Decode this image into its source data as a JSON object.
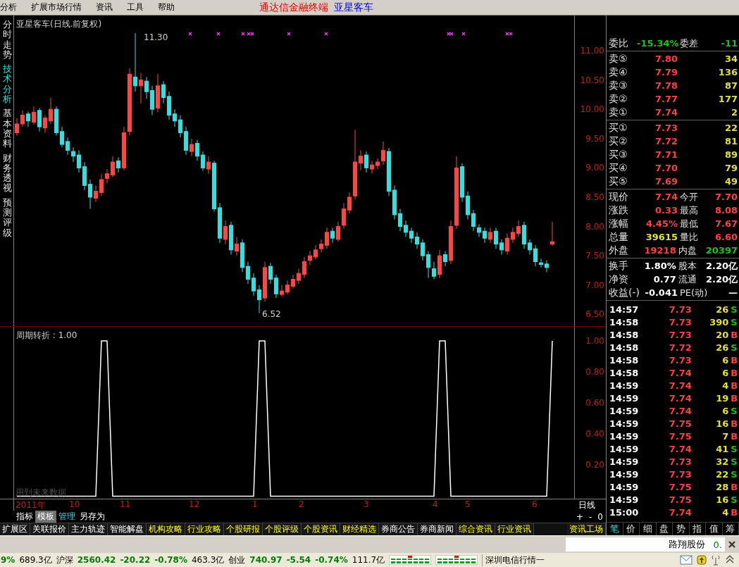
{
  "menu": [
    "分析",
    "扩展市场行情",
    "资讯",
    "工具",
    "帮助"
  ],
  "app_title": {
    "product": "通达信金融终端",
    "stock": "亚星客车"
  },
  "side_tabs": [
    {
      "label": "分时走势",
      "selected": false
    },
    {
      "label": "技术分析",
      "selected": true
    },
    {
      "label": "基本资料",
      "selected": false
    },
    {
      "label": "财务透视",
      "selected": false
    },
    {
      "label": "预测评级",
      "selected": false
    }
  ],
  "main_chart": {
    "title": "亚星客车(日线.前复权)",
    "high_label": "11.30",
    "low_label": "6.52",
    "chart_data": {
      "type": "candlestick",
      "ylim": [
        6.3,
        11.6
      ],
      "yticks": [
        {
          "value": 11,
          "label": "11.00"
        },
        {
          "value": 10.5,
          "label": "10.50"
        },
        {
          "value": 10,
          "label": "10.00"
        },
        {
          "value": 9.5,
          "label": "9.50"
        },
        {
          "value": 9,
          "label": "9.00"
        },
        {
          "value": 8.5,
          "label": "8.50"
        },
        {
          "value": 8,
          "label": "8.00"
        },
        {
          "value": 7.5,
          "label": "7.50"
        },
        {
          "value": 7,
          "label": "7.00"
        },
        {
          "value": 6.5,
          "label": "6.50"
        }
      ],
      "categories": [
        null,
        null,
        null,
        null,
        null,
        null,
        null,
        null,
        null,
        null,
        null,
        null,
        null,
        null,
        null,
        null,
        null,
        null,
        null,
        null,
        null,
        null,
        null,
        null,
        null,
        null,
        null,
        null,
        null,
        null,
        null,
        null,
        null,
        null,
        null,
        null,
        null,
        null,
        null,
        null,
        null,
        null,
        null,
        null,
        null,
        null,
        null,
        null,
        null,
        null,
        null,
        null,
        null,
        null,
        null,
        null,
        null,
        null,
        null,
        null,
        null,
        null,
        null,
        null,
        null,
        null,
        null,
        null,
        null,
        null,
        null,
        null,
        null,
        null,
        null,
        null,
        null,
        null,
        null,
        null,
        null,
        null,
        null,
        null,
        null,
        null,
        null,
        null,
        null,
        null,
        null,
        null,
        null,
        null,
        null,
        null
      ],
      "ohlc": [
        [
          9.6,
          9.85,
          9.55,
          9.75
        ],
        [
          9.75,
          9.98,
          9.7,
          9.9
        ],
        [
          9.92,
          9.96,
          9.7,
          9.8
        ],
        [
          9.78,
          10.05,
          9.74,
          9.95
        ],
        [
          9.98,
          10.02,
          9.62,
          9.7
        ],
        [
          9.68,
          9.9,
          9.6,
          9.85
        ],
        [
          9.8,
          10.2,
          9.75,
          10.0
        ],
        [
          10.0,
          10.05,
          9.55,
          9.6
        ],
        [
          9.62,
          9.7,
          9.35,
          9.4
        ],
        [
          9.45,
          9.52,
          9.22,
          9.3
        ],
        [
          9.28,
          9.35,
          9.1,
          9.2
        ],
        [
          9.22,
          9.3,
          8.92,
          9.0
        ],
        [
          9.02,
          9.1,
          8.62,
          8.7
        ],
        [
          8.72,
          8.8,
          8.3,
          8.5
        ],
        [
          8.48,
          8.7,
          8.42,
          8.6
        ],
        [
          8.58,
          8.9,
          8.52,
          8.8
        ],
        [
          8.82,
          8.98,
          8.74,
          8.9
        ],
        [
          8.88,
          9.2,
          8.84,
          9.1
        ],
        [
          9.12,
          9.18,
          8.92,
          9.0
        ],
        [
          9.0,
          9.7,
          8.96,
          9.6
        ],
        [
          9.62,
          10.7,
          9.55,
          10.6
        ],
        [
          10.55,
          11.3,
          10.3,
          10.4
        ],
        [
          10.4,
          10.62,
          10.1,
          10.5
        ],
        [
          10.48,
          10.55,
          10.18,
          10.3
        ],
        [
          10.32,
          10.4,
          9.9,
          10.0
        ],
        [
          10.02,
          10.6,
          9.95,
          10.4
        ],
        [
          10.42,
          10.48,
          10.1,
          10.2
        ],
        [
          10.22,
          10.3,
          9.82,
          9.9
        ],
        [
          9.92,
          10.0,
          9.7,
          9.8
        ],
        [
          9.82,
          9.9,
          9.52,
          9.6
        ],
        [
          9.62,
          9.7,
          9.22,
          9.3
        ],
        [
          9.28,
          9.5,
          9.2,
          9.4
        ],
        [
          9.42,
          9.48,
          9.12,
          9.2
        ],
        [
          9.22,
          9.28,
          8.95,
          9.0
        ],
        [
          8.98,
          9.2,
          8.9,
          9.1
        ],
        [
          9.08,
          9.12,
          8.25,
          8.3
        ],
        [
          8.32,
          8.4,
          7.72,
          7.8
        ],
        [
          7.78,
          8.1,
          7.7,
          8.0
        ],
        [
          8.02,
          8.08,
          7.52,
          7.6
        ],
        [
          7.58,
          7.82,
          7.5,
          7.7
        ],
        [
          7.72,
          7.78,
          7.22,
          7.3
        ],
        [
          7.32,
          7.4,
          7.02,
          7.1
        ],
        [
          7.12,
          7.2,
          6.82,
          6.9
        ],
        [
          6.92,
          7.0,
          6.52,
          6.75
        ],
        [
          6.78,
          7.4,
          6.72,
          7.3
        ],
        [
          7.32,
          7.38,
          7.02,
          7.1
        ],
        [
          7.12,
          7.18,
          6.78,
          6.85
        ],
        [
          6.84,
          7.0,
          6.8,
          6.9
        ],
        [
          6.88,
          7.08,
          6.84,
          7.0
        ],
        [
          6.98,
          7.18,
          6.94,
          7.1
        ],
        [
          7.08,
          7.28,
          7.02,
          7.2
        ],
        [
          7.18,
          7.48,
          7.12,
          7.4
        ],
        [
          7.42,
          7.58,
          7.34,
          7.5
        ],
        [
          7.48,
          7.68,
          7.44,
          7.6
        ],
        [
          7.62,
          7.78,
          7.56,
          7.7
        ],
        [
          7.68,
          7.98,
          7.62,
          7.9
        ],
        [
          7.92,
          7.98,
          7.72,
          7.8
        ],
        [
          7.78,
          8.08,
          7.74,
          8.0
        ],
        [
          8.02,
          8.4,
          7.96,
          8.3
        ],
        [
          8.28,
          8.58,
          8.22,
          8.5
        ],
        [
          8.52,
          9.65,
          8.46,
          9.1
        ],
        [
          9.08,
          9.3,
          8.96,
          9.2
        ],
        [
          9.22,
          9.28,
          8.92,
          9.0
        ],
        [
          8.98,
          9.12,
          8.9,
          9.05
        ],
        [
          9.04,
          9.16,
          8.98,
          9.1
        ],
        [
          9.12,
          9.45,
          9.05,
          9.3
        ],
        [
          9.28,
          9.34,
          8.52,
          8.6
        ],
        [
          8.62,
          8.7,
          8.12,
          8.2
        ],
        [
          8.22,
          8.3,
          7.92,
          8.0
        ],
        [
          8.02,
          8.1,
          7.82,
          7.9
        ],
        [
          7.92,
          7.98,
          7.72,
          7.8
        ],
        [
          7.82,
          7.9,
          7.62,
          7.7
        ],
        [
          7.72,
          7.78,
          7.42,
          7.5
        ],
        [
          7.52,
          7.58,
          7.12,
          7.3
        ],
        [
          7.28,
          7.4,
          7.1,
          7.15
        ],
        [
          7.18,
          7.6,
          7.12,
          7.5
        ],
        [
          7.52,
          7.58,
          7.32,
          7.4
        ],
        [
          7.42,
          8.1,
          7.36,
          8.0
        ],
        [
          8.02,
          9.2,
          7.96,
          9.0
        ],
        [
          9.02,
          9.08,
          8.42,
          8.5
        ],
        [
          8.52,
          8.6,
          8.12,
          8.2
        ],
        [
          8.22,
          8.28,
          7.92,
          8.0
        ],
        [
          7.98,
          8.04,
          7.82,
          7.9
        ],
        [
          7.92,
          7.98,
          7.72,
          7.8
        ],
        [
          7.78,
          7.98,
          7.72,
          7.9
        ],
        [
          7.92,
          7.98,
          7.62,
          7.7
        ],
        [
          7.72,
          7.78,
          7.52,
          7.6
        ],
        [
          7.58,
          7.88,
          7.52,
          7.8
        ],
        [
          7.78,
          7.98,
          7.72,
          7.9
        ],
        [
          7.88,
          8.1,
          7.82,
          8.0
        ],
        [
          8.02,
          8.08,
          7.62,
          7.7
        ],
        [
          7.72,
          7.78,
          7.52,
          7.6
        ],
        [
          7.62,
          7.68,
          7.32,
          7.4
        ],
        [
          7.38,
          7.45,
          7.3,
          7.35
        ],
        [
          7.36,
          7.42,
          7.22,
          7.3
        ],
        [
          7.7,
          8.08,
          7.67,
          7.74
        ]
      ]
    }
  },
  "indicator": {
    "note": "用到未来数据",
    "chart_data": {
      "type": "line",
      "title": "周期转折 : 1.00",
      "ylim": [
        -0.02,
        1.09
      ],
      "categories": [
        null,
        null,
        null,
        null,
        null,
        null,
        null,
        null,
        null,
        null,
        null,
        null,
        null,
        null,
        null,
        null,
        null,
        null,
        null,
        null,
        null,
        null,
        null,
        null,
        null,
        null,
        null,
        null,
        null,
        null,
        null,
        null,
        null,
        null,
        null,
        null,
        null,
        null,
        null,
        null,
        null,
        null,
        null,
        null,
        null,
        null,
        null,
        null,
        null,
        null,
        null,
        null,
        null,
        null,
        null,
        null,
        null,
        null,
        null,
        null,
        null,
        null,
        null,
        null,
        null,
        null,
        null,
        null,
        null,
        null,
        null,
        null,
        null,
        null,
        null,
        null,
        null,
        null,
        null,
        null,
        null,
        null,
        null,
        null,
        null,
        null,
        null,
        null,
        null,
        null,
        null,
        null,
        null,
        null,
        null,
        null
      ],
      "series": [
        {
          "color": "#ffffff",
          "values": [
            0,
            0,
            0,
            0,
            0,
            0,
            0,
            0,
            0,
            0,
            0,
            0,
            0,
            0,
            0,
            1,
            1,
            0,
            0,
            0,
            0,
            0,
            0,
            0,
            0,
            0,
            0,
            0,
            0,
            0,
            0,
            0,
            0,
            0,
            0,
            0,
            0,
            0,
            0,
            0,
            0,
            0,
            0,
            1,
            1,
            0,
            0,
            0,
            0,
            0,
            0,
            0,
            0,
            0,
            0,
            0,
            0,
            0,
            0,
            0,
            0,
            0,
            0,
            0,
            0,
            0,
            0,
            0,
            0,
            0,
            0,
            0,
            0,
            0,
            0,
            1,
            1,
            0,
            0,
            0,
            0,
            0,
            0,
            0,
            0,
            0,
            0,
            0,
            0,
            0,
            0,
            0,
            0,
            0,
            0,
            1
          ]
        }
      ],
      "yticks": [
        {
          "value": 1,
          "label": "1.00"
        },
        {
          "value": 0.8,
          "label": "0.80"
        },
        {
          "value": 0.6,
          "label": "0.60"
        },
        {
          "value": 0.4,
          "label": "0.40"
        },
        {
          "value": 0.2,
          "label": "0.20"
        }
      ]
    }
  },
  "time_axis": [
    "2011年",
    "10",
    "11",
    "12",
    "1",
    "2",
    "3",
    "4",
    "5",
    "6"
  ],
  "period": "日线",
  "chart_tabs": [
    {
      "label": "指标",
      "selected": false
    },
    {
      "label": "模板",
      "selected": true
    },
    {
      "label": "管理",
      "selected": false
    },
    {
      "label": "另存为",
      "selected": false
    }
  ],
  "zoom_controls": [
    "+",
    "-",
    "0"
  ],
  "info_tabs": [
    {
      "label": "扩展区",
      "highlighted": false
    },
    {
      "label": "关联报价",
      "highlighted": false
    },
    {
      "label": "主力轨迹",
      "highlighted": false
    },
    {
      "label": "智能解盘",
      "highlighted": false
    },
    {
      "label": "机构攻略",
      "highlighted": true
    },
    {
      "label": "行业攻略",
      "highlighted": true
    },
    {
      "label": "个股研报",
      "highlighted": true
    },
    {
      "label": "个股评级",
      "highlighted": true
    },
    {
      "label": "个股资讯",
      "highlighted": true
    },
    {
      "label": "财经精选",
      "highlighted": true
    },
    {
      "label": "券商公告",
      "highlighted": false
    },
    {
      "label": "券商新闻",
      "highlighted": false
    },
    {
      "label": "综合资讯",
      "highlighted": true
    },
    {
      "label": "行业资讯",
      "highlighted": true
    }
  ],
  "info_workshop": "资讯工场",
  "quote": {
    "ratio": {
      "label": "委比",
      "value": "-15.34%",
      "diff_label": "委差",
      "diff": "-11"
    },
    "asks": [
      {
        "label": "卖⑤",
        "price": "7.80",
        "volume": "34"
      },
      {
        "label": "卖④",
        "price": "7.79",
        "volume": "136"
      },
      {
        "label": "卖③",
        "price": "7.78",
        "volume": "87"
      },
      {
        "label": "卖②",
        "price": "7.77",
        "volume": "177"
      },
      {
        "label": "卖①",
        "price": "7.74",
        "volume": "2"
      }
    ],
    "bids": [
      {
        "label": "买①",
        "price": "7.73",
        "volume": "22"
      },
      {
        "label": "买②",
        "price": "7.72",
        "volume": "81"
      },
      {
        "label": "买③",
        "price": "7.71",
        "volume": "89"
      },
      {
        "label": "买④",
        "price": "7.70",
        "volume": "79"
      },
      {
        "label": "买⑤",
        "price": "7.69",
        "volume": "49"
      }
    ],
    "stats": [
      {
        "left": {
          "label": "现价",
          "value": "7.74",
          "color": "#ff4040"
        },
        "right": {
          "label": "今开",
          "value": "7.70",
          "color": "#ff4040"
        }
      },
      {
        "left": {
          "label": "涨跌",
          "value": "0.33",
          "color": "#ff4040"
        },
        "right": {
          "label": "最高",
          "value": "8.08",
          "color": "#ff4040"
        }
      },
      {
        "left": {
          "label": "涨幅",
          "value": "4.45%",
          "color": "#ff4040"
        },
        "right": {
          "label": "最低",
          "value": "7.67",
          "color": "#ff4040"
        }
      },
      {
        "left": {
          "label": "总量",
          "value": "39615",
          "color": "#e0e040"
        },
        "right": {
          "label": "量比",
          "value": "6.60",
          "color": "#ff4040"
        }
      },
      {
        "left": {
          "label": "外盘",
          "value": "19218",
          "color": "#ff4040"
        },
        "right": {
          "label": "内盘",
          "value": "20397",
          "color": "#20c020"
        }
      }
    ],
    "fundamentals": [
      {
        "label": "换手",
        "value": "1.80%",
        "label2": "股本",
        "value2": "2.20亿"
      },
      {
        "label": "净资",
        "value": "0.77",
        "label2": "流通",
        "value2": "2.20亿"
      },
      {
        "label": "收益(-)",
        "value": "-0.041",
        "label2": "PE(动)",
        "value2": "—"
      }
    ]
  },
  "ticks": [
    {
      "time": "14:57",
      "price": "7.73",
      "volume": "26",
      "side": "S",
      "color": "#20c020"
    },
    {
      "time": "14:58",
      "price": "7.73",
      "volume": "390",
      "side": "S",
      "color": "#20c020"
    },
    {
      "time": "14:58",
      "price": "7.73",
      "volume": "20",
      "side": "B",
      "color": "#ff4040"
    },
    {
      "time": "14:58",
      "price": "7.72",
      "volume": "26",
      "side": "S",
      "color": "#20c020"
    },
    {
      "time": "14:58",
      "price": "7.73",
      "volume": "6",
      "side": "B",
      "color": "#ff4040"
    },
    {
      "time": "14:58",
      "price": "7.74",
      "volume": "6",
      "side": "B",
      "color": "#ff4040"
    },
    {
      "time": "14:59",
      "price": "7.74",
      "volume": "4",
      "side": "B",
      "color": "#ff4040"
    },
    {
      "time": "14:59",
      "price": "7.74",
      "volume": "19",
      "side": "B",
      "color": "#ff4040"
    },
    {
      "time": "14:59",
      "price": "7.74",
      "volume": "6",
      "side": "S",
      "color": "#20c020"
    },
    {
      "time": "14:59",
      "price": "7.75",
      "volume": "16",
      "side": "B",
      "color": "#ff4040"
    },
    {
      "time": "14:59",
      "price": "7.75",
      "volume": "7",
      "side": "B",
      "color": "#ff4040"
    },
    {
      "time": "14:59",
      "price": "7.74",
      "volume": "41",
      "side": "S",
      "color": "#20c020"
    },
    {
      "time": "14:59",
      "price": "7.73",
      "volume": "32",
      "side": "S",
      "color": "#20c020"
    },
    {
      "time": "14:59",
      "price": "7.73",
      "volume": "22",
      "side": "S",
      "color": "#20c020"
    },
    {
      "time": "14:59",
      "price": "7.75",
      "volume": "28",
      "side": "B",
      "color": "#ff4040"
    },
    {
      "time": "14:59",
      "price": "7.75",
      "volume": "16",
      "side": "S",
      "color": "#20c020"
    },
    {
      "time": "15:00",
      "price": "7.74",
      "volume": "4",
      "side": "B",
      "color": "#ff4040"
    }
  ],
  "panel_tabs": [
    {
      "label": "笔",
      "selected": true
    },
    {
      "label": "价",
      "selected": false
    },
    {
      "label": "细",
      "selected": false
    },
    {
      "label": "盘",
      "selected": false
    },
    {
      "label": "势",
      "selected": false
    },
    {
      "label": "指",
      "selected": false
    },
    {
      "label": "值",
      "selected": false
    },
    {
      "label": "筹",
      "selected": false
    }
  ],
  "ticker": {
    "name": "路翔股份",
    "value": "0."
  },
  "status_bar": [
    {
      "text": "9%",
      "kind": "change"
    },
    {
      "text": "689.3亿",
      "kind": "plain"
    },
    {
      "text": "沪深",
      "kind": "plain"
    },
    {
      "text": "2560.42",
      "kind": "change"
    },
    {
      "text": "-20.22",
      "kind": "change"
    },
    {
      "text": "-0.78%",
      "kind": "change"
    },
    {
      "text": "463.3亿",
      "kind": "plain"
    },
    {
      "text": "创业",
      "kind": "plain"
    },
    {
      "text": "740.97",
      "kind": "change"
    },
    {
      "text": "-5.54",
      "kind": "change"
    },
    {
      "text": "-0.74%",
      "kind": "change"
    },
    {
      "text": "111.7亿",
      "kind": "plain"
    }
  ],
  "feed": "深圳电信行情一"
}
